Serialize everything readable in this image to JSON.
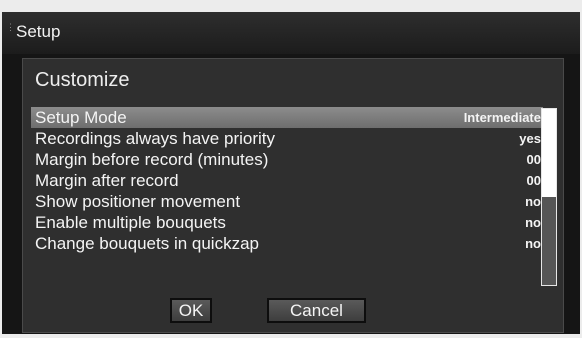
{
  "window": {
    "title": "Setup"
  },
  "panel": {
    "heading": "Customize"
  },
  "settings": [
    {
      "label": "Setup Mode",
      "value": "Intermediate",
      "selected": true
    },
    {
      "label": "Recordings always have priority",
      "value": "yes",
      "selected": false
    },
    {
      "label": "Margin before record (minutes)",
      "value": "00",
      "selected": false
    },
    {
      "label": "Margin after record",
      "value": "00",
      "selected": false
    },
    {
      "label": "Show positioner movement",
      "value": "no",
      "selected": false
    },
    {
      "label": "Enable multiple bouquets",
      "value": "no",
      "selected": false
    },
    {
      "label": "Change bouquets in quickzap",
      "value": "no",
      "selected": false
    }
  ],
  "buttons": {
    "ok_label": "OK",
    "cancel_label": "Cancel"
  },
  "scrollbar": {
    "visible_fraction": 0.5
  },
  "colors": {
    "window_bg": "#151515",
    "panel_bg": "#2f2f2f",
    "selection": "#7c7c7c",
    "text": "#f4f4f4"
  }
}
